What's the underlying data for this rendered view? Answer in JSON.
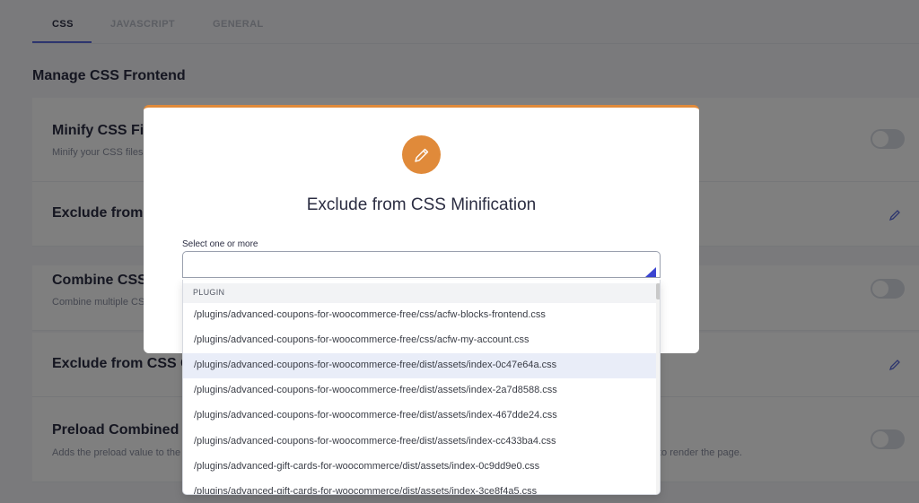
{
  "tabs": [
    "CSS",
    "JAVASCRIPT",
    "GENERAL"
  ],
  "section_title": "Manage CSS Frontend",
  "cards": [
    {
      "title": "Minify CSS Files",
      "desc": "Minify your CSS files"
    },
    {
      "title": "Exclude from CSS Minification"
    },
    {
      "title": "Combine CSS Files",
      "desc": "Combine multiple CSS files"
    },
    {
      "title": "Exclude from CSS Combine"
    },
    {
      "title": "Preload Combined CSS",
      "desc": "Adds the preload value to the combined CSS file",
      "desc_tail": "to render the page."
    }
  ],
  "modal": {
    "title": "Exclude from CSS Minification",
    "field_label": "Select one or more",
    "icon": "pencil-icon"
  },
  "dropdown": {
    "group": "PLUGIN",
    "options": [
      "/plugins/advanced-coupons-for-woocommerce-free/css/acfw-blocks-frontend.css",
      "/plugins/advanced-coupons-for-woocommerce-free/css/acfw-my-account.css",
      "/plugins/advanced-coupons-for-woocommerce-free/dist/assets/index-0c47e64a.css",
      "/plugins/advanced-coupons-for-woocommerce-free/dist/assets/index-2a7d8588.css",
      "/plugins/advanced-coupons-for-woocommerce-free/dist/assets/index-467dde24.css",
      "/plugins/advanced-coupons-for-woocommerce-free/dist/assets/index-cc433ba4.css",
      "/plugins/advanced-gift-cards-for-woocommerce/dist/assets/index-0c9dd9e0.css",
      "/plugins/advanced-gift-cards-for-woocommerce/dist/assets/index-3ce8f4a5.css"
    ]
  },
  "colors": {
    "accent": "#e08a3a",
    "primary": "#5b6bdc",
    "highlight": "#e9edf8"
  }
}
